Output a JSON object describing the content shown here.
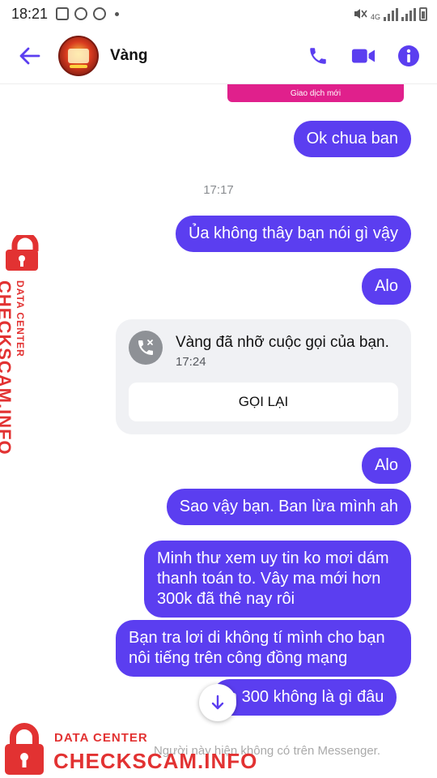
{
  "status_bar": {
    "time": "18:21",
    "network": "4G"
  },
  "header": {
    "contact_name": "Vàng",
    "icons": [
      "back-arrow-icon",
      "phone-icon",
      "video-camera-icon",
      "info-icon"
    ]
  },
  "colors": {
    "accent": "#5b3ef0",
    "outgoing_bubble": "#5b3ef0",
    "pink_card": "#e0208c",
    "watermark": "#e23232"
  },
  "chat": {
    "pink_card_label": "Giao dịch mới",
    "messages": [
      {
        "text": "Ok chua ban"
      },
      {
        "text": "Ủa không thây bạn nói gì vậy"
      },
      {
        "text": "Alo"
      },
      {
        "text": "Alo"
      },
      {
        "text": "Sao vậy bạn. Ban lừa mình ah"
      },
      {
        "text": "Minh thư xem uy tin ko mơi dám thanh toán to. Vây ma mới hơn 300k đã thê nay rôi"
      },
      {
        "text": "Bạn tra lơi di không tí mình cho bạn nôi tiếng trên công đồng mạng"
      },
      {
        "text": "n 300 không là gì đâu"
      }
    ],
    "timestamp": "17:17",
    "missed_call": {
      "text": "Vàng đã nhỡ cuộc gọi của bạn.",
      "time": "17:24",
      "button_label": "GỌI LẠI"
    },
    "footer_note": "Người này hiện không có trên Messenger."
  },
  "watermark": {
    "small": "DATA CENTER",
    "big": "CHECKSCAM.INFO"
  }
}
